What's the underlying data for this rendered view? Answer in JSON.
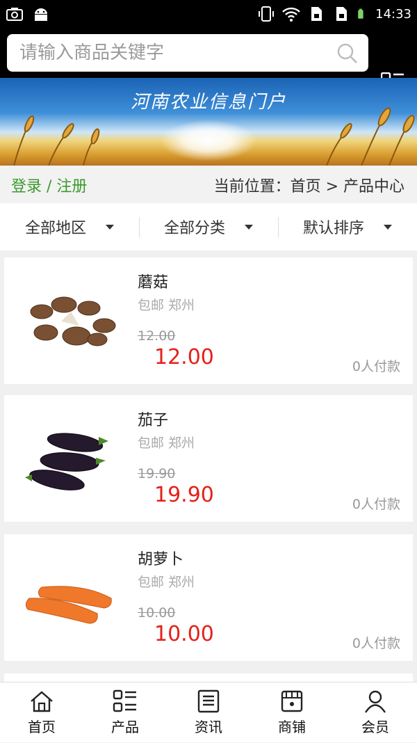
{
  "status": {
    "time": "14:33",
    "left_icons": [
      "screenshot-icon",
      "android-icon"
    ],
    "right_icons": [
      "vibrate-icon",
      "wifi-icon",
      "sim1-icon",
      "sim2-icon",
      "battery-icon"
    ]
  },
  "search": {
    "placeholder": "请输入商品关键字",
    "value": ""
  },
  "banner": {
    "title": "河南农业信息门户"
  },
  "crumb": {
    "login_label": "登录 / 注册",
    "location": "当前位置：首页 > 产品中心"
  },
  "filters": [
    {
      "label": "全部地区"
    },
    {
      "label": "全部分类"
    },
    {
      "label": "默认排序"
    }
  ],
  "products": [
    {
      "name": "蘑菇",
      "meta": "包邮 郑州",
      "old_price": "12.00",
      "price": "12.00",
      "paid": "0人付款"
    },
    {
      "name": "茄子",
      "meta": "包邮 郑州",
      "old_price": "19.90",
      "price": "19.90",
      "paid": "0人付款"
    },
    {
      "name": "胡萝卜",
      "meta": "包邮 郑州",
      "old_price": "10.00",
      "price": "10.00",
      "paid": "0人付款"
    }
  ],
  "tabs": [
    {
      "label": "首页",
      "icon": "home-icon"
    },
    {
      "label": "产品",
      "icon": "grid-list-icon"
    },
    {
      "label": "资讯",
      "icon": "news-icon"
    },
    {
      "label": "商铺",
      "icon": "store-icon"
    },
    {
      "label": "会员",
      "icon": "user-icon"
    }
  ],
  "colors": {
    "accent_green": "#3a9a2c",
    "price_red": "#e52019"
  }
}
